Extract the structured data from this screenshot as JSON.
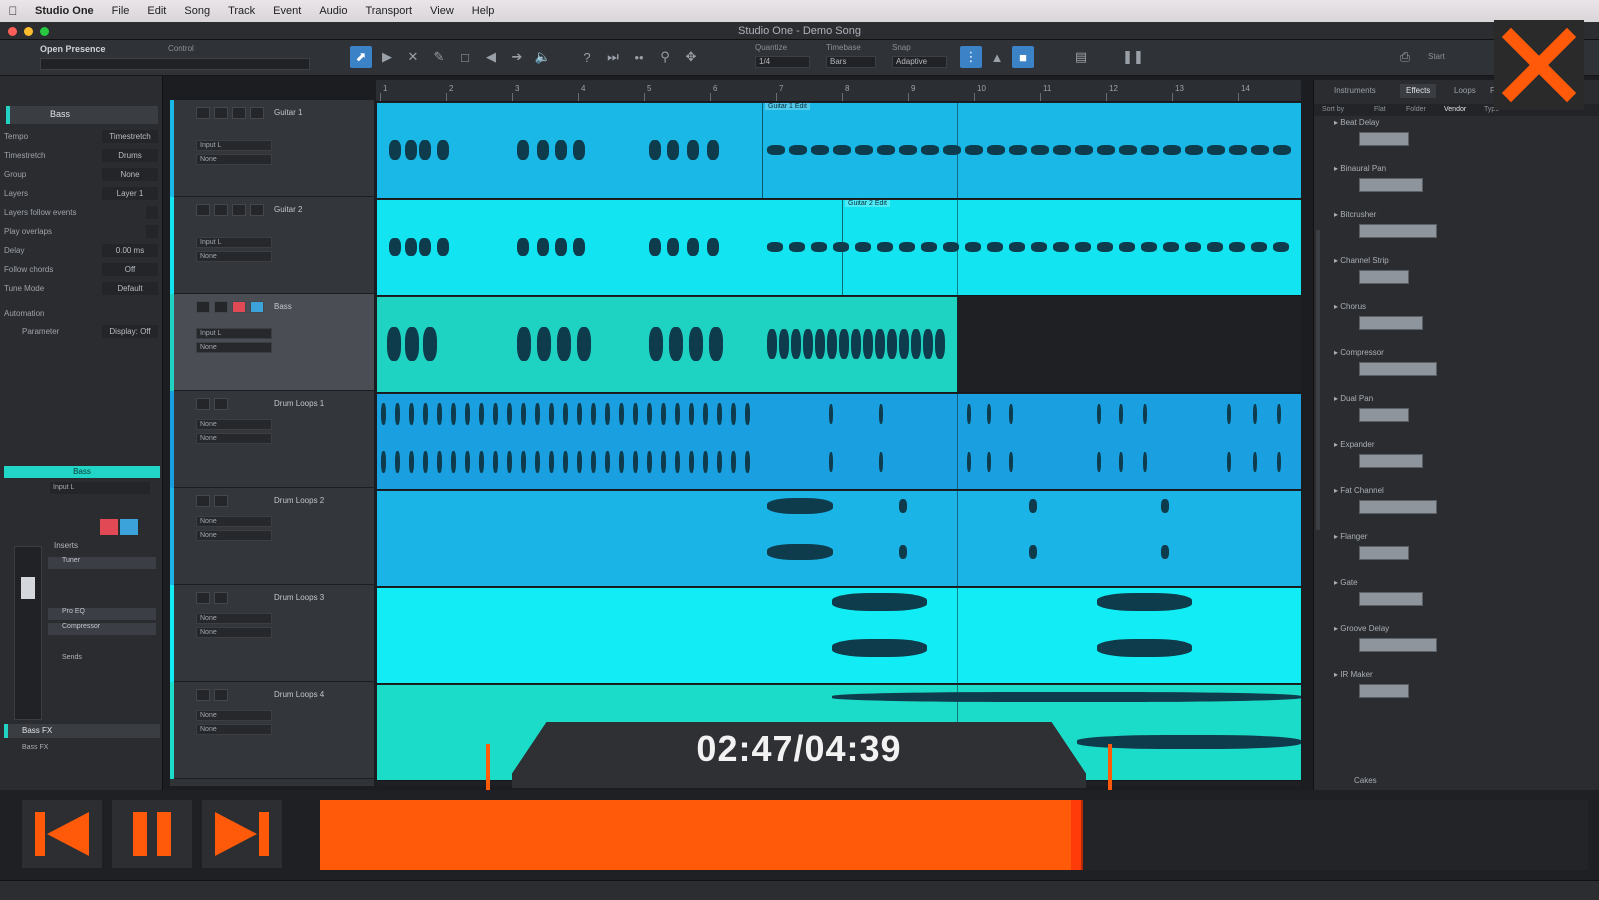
{
  "menubar": {
    "app_name": "Studio One",
    "items": [
      "File",
      "Edit",
      "Song",
      "Track",
      "Event",
      "Audio",
      "Transport",
      "View",
      "Help"
    ]
  },
  "window": {
    "title": "Studio One - Demo Song"
  },
  "toolbar": {
    "preset_label": "Open Presence",
    "control_label": "Control",
    "quantize_label": "Quantize",
    "quantize_value": "1/4",
    "timebase_label": "Timebase",
    "timebase_value": "Bars",
    "snap_label": "Snap",
    "snap_value": "Adaptive",
    "start_label": "Start"
  },
  "inspector": {
    "title": "Bass",
    "rows": [
      {
        "label": "Tempo",
        "value": "Timestretch"
      },
      {
        "label": "Timestretch",
        "value": "Drums"
      },
      {
        "label": "Group",
        "value": "None"
      },
      {
        "label": "Layers",
        "value": "Layer 1"
      },
      {
        "label": "Layers follow events",
        "value": ""
      },
      {
        "label": "Play overlaps",
        "value": ""
      },
      {
        "label": "Delay",
        "value": "0.00 ms"
      },
      {
        "label": "Follow chords",
        "value": "Off"
      },
      {
        "label": "Tune Mode",
        "value": "Default"
      },
      {
        "label": "Automation",
        "value": ""
      },
      {
        "label": "Parameter",
        "value": "Display: Off"
      }
    ],
    "channel_label": "Bass",
    "input_label": "Input L",
    "inserts_label": "Inserts",
    "insert_items": [
      "Tuner",
      "Pro EQ",
      "Compressor"
    ],
    "sends_label": "Sends",
    "footer_label": "Bass FX",
    "footer_value": "Bass FX"
  },
  "tracks": [
    {
      "name": "Guitar 1",
      "input": "Input L",
      "output": "None",
      "color": "#19b8e6"
    },
    {
      "name": "Guitar 2",
      "input": "Input L",
      "output": "None",
      "color": "#12e4f2"
    },
    {
      "name": "Bass",
      "input": "Input L",
      "output": "None",
      "color": "#1fd3c2"
    },
    {
      "name": "Drum Loops 1",
      "input": "None",
      "output": "None",
      "color": "#1a9fe0"
    },
    {
      "name": "Drum Loops 2",
      "input": "None",
      "output": "None",
      "color": "#1ab4e6"
    },
    {
      "name": "Drum Loops 3",
      "input": "None",
      "output": "None",
      "color": "#12ecf5"
    },
    {
      "name": "Drum Loops 4",
      "input": "None",
      "output": "None",
      "color": "#1bdcc9"
    }
  ],
  "clip_labels": [
    "Guitar 1 Edit",
    "Guitar 2 Edit"
  ],
  "ruler": {
    "bars": [
      "1",
      "2",
      "3",
      "4",
      "5",
      "6",
      "7",
      "8",
      "9",
      "10",
      "11",
      "12",
      "13",
      "14"
    ]
  },
  "browser": {
    "tabs": [
      "Instruments",
      "Effects",
      "Loops",
      "Files"
    ],
    "columns": [
      "Sort by",
      "Flat",
      "Folder",
      "Vendor",
      "Type"
    ],
    "effects": [
      "Beat Delay",
      "Binaural Pan",
      "Bitcrusher",
      "Channel Strip",
      "Chorus",
      "Compressor",
      "Dual Pan",
      "Expander",
      "Fat Channel",
      "Flanger",
      "Gate",
      "Groove Delay",
      "IR Maker"
    ],
    "footer": "Cakes"
  },
  "player": {
    "time": "02:47/04:39",
    "progress": 0.6,
    "accent": "#ff5a0a"
  }
}
